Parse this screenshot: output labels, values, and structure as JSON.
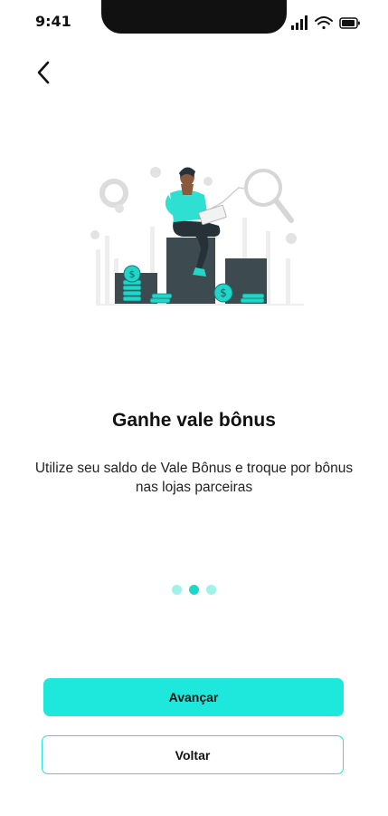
{
  "status_bar": {
    "time": "9:41"
  },
  "icons": {
    "back": "chevron-left-icon",
    "signal": "signal-icon",
    "wifi": "wifi-icon",
    "battery": "battery-icon"
  },
  "colors": {
    "accent": "#1ee8db",
    "dot_inactive": "#9ef2ea",
    "dot_active": "#1ad9cc"
  },
  "onboarding": {
    "title": "Ganhe vale bônus",
    "subtitle": "Utilize seu saldo de Vale Bônus e troque por bônus nas lojas parceiras",
    "page_count": 3,
    "current_page": 2
  },
  "actions": {
    "next_label": "Avançar",
    "back_label": "Voltar"
  }
}
